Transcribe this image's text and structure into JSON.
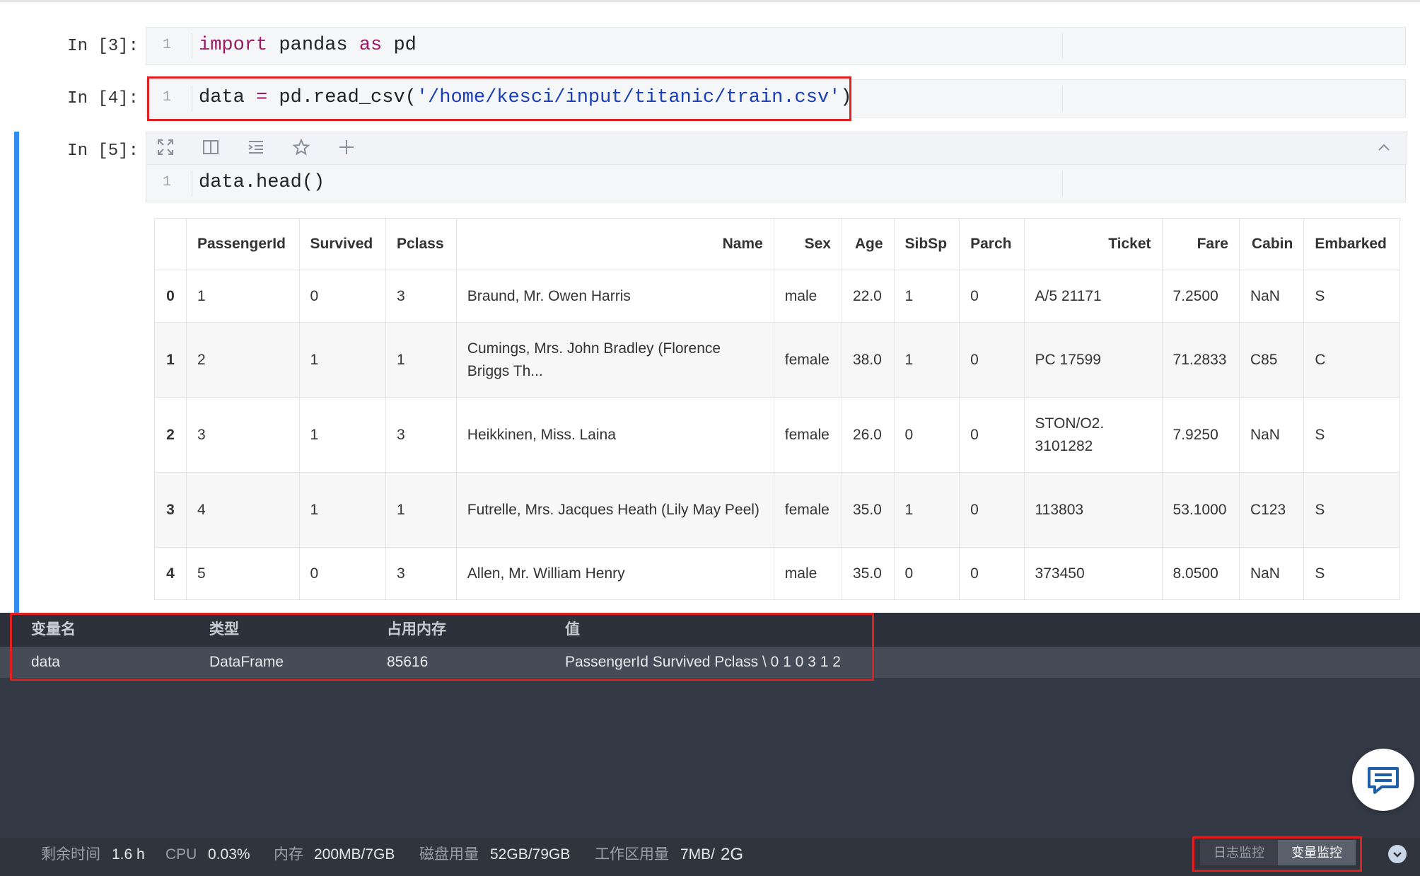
{
  "cells": [
    {
      "prompt": "In [3]:",
      "lineno": "1",
      "code": {
        "kw1": "import",
        "mid": " pandas ",
        "kw2": "as",
        "end": " pd"
      }
    },
    {
      "prompt": "In [4]:",
      "lineno": "1",
      "code": {
        "pre": "data ",
        "op": "=",
        "mid": " pd.read_csv(",
        "str": "'/home/kesci/input/titanic/train.csv'",
        "end": ")"
      }
    },
    {
      "prompt": "In [5]:",
      "lineno": "1",
      "code": {
        "text": "data.head()"
      }
    }
  ],
  "toolbar": {
    "icons": [
      "expand-icon",
      "split-view-icon",
      "indent-icon",
      "star-icon",
      "plus-icon",
      "chevron-up-icon"
    ]
  },
  "dataframe": {
    "columns": [
      "",
      "PassengerId",
      "Survived",
      "Pclass",
      "Name",
      "Sex",
      "Age",
      "SibSp",
      "Parch",
      "Ticket",
      "Fare",
      "Cabin",
      "Embarked"
    ],
    "rows": [
      [
        "0",
        "1",
        "0",
        "3",
        "Braund, Mr. Owen Harris",
        "male",
        "22.0",
        "1",
        "0",
        "A/5 21171",
        "7.2500",
        "NaN",
        "S"
      ],
      [
        "1",
        "2",
        "1",
        "1",
        "Cumings, Mrs. John Bradley (Florence Briggs Th...",
        "female",
        "38.0",
        "1",
        "0",
        "PC 17599",
        "71.2833",
        "C85",
        "C"
      ],
      [
        "2",
        "3",
        "1",
        "3",
        "Heikkinen, Miss. Laina",
        "female",
        "26.0",
        "0",
        "0",
        "STON/O2. 3101282",
        "7.9250",
        "NaN",
        "S"
      ],
      [
        "3",
        "4",
        "1",
        "1",
        "Futrelle, Mrs. Jacques Heath (Lily May Peel)",
        "female",
        "35.0",
        "1",
        "0",
        "113803",
        "53.1000",
        "C123",
        "S"
      ],
      [
        "4",
        "5",
        "0",
        "3",
        "Allen, Mr. William Henry",
        "male",
        "35.0",
        "0",
        "0",
        "373450",
        "8.0500",
        "NaN",
        "S"
      ]
    ]
  },
  "variables": {
    "headers": {
      "name": "变量名",
      "type": "类型",
      "memory": "占用内存",
      "value": "值"
    },
    "rows": [
      {
        "name": "data",
        "type": "DataFrame",
        "memory": "85616",
        "value": "PassengerId Survived Pclass \\ 0 1 0 3 1 2"
      }
    ]
  },
  "status": {
    "remaining_label": "剩余时间",
    "remaining_value": "1.6 h",
    "cpu_label": "CPU",
    "cpu_value": "0.03%",
    "mem_label": "内存",
    "mem_value": "200MB/7GB",
    "disk_label": "磁盘用量",
    "disk_value": "52GB/79GB",
    "workspace_label": "工作区用量",
    "workspace_value": "7MB/",
    "workspace_total": "2G"
  },
  "monitor_tabs": {
    "log": "日志监控",
    "vars": "变量监控"
  },
  "colors": {
    "accent": "#2f8cf0",
    "highlight": "#e02020",
    "panel": "#343a45",
    "keyword": "#9a1a64",
    "string": "#1a3fb5"
  }
}
